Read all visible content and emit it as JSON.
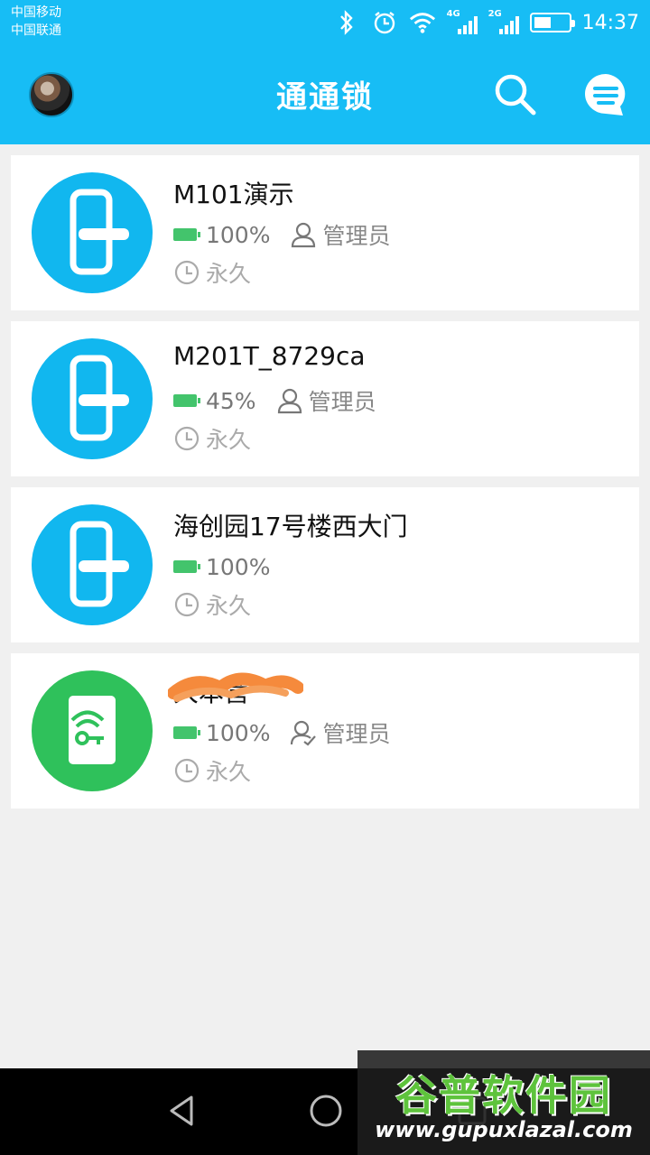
{
  "status_bar": {
    "carrier_1": "中国移动",
    "carrier_2": "中国联通",
    "signal_1_label": "4G",
    "signal_2_label": "2G",
    "time": "14:37"
  },
  "app_bar": {
    "title": "通通锁",
    "color": "#17bdf5"
  },
  "locks": [
    {
      "name": "M101演示",
      "battery": "100%",
      "role": "管理员",
      "validity": "永久",
      "icon": "door-lock-icon",
      "icon_color": "#11b7ef"
    },
    {
      "name": "M201T_8729ca",
      "battery": "45%",
      "role": "管理员",
      "validity": "永久",
      "icon": "door-lock-icon",
      "icon_color": "#11b7ef"
    },
    {
      "name": "海创园17号楼西大门",
      "battery": "100%",
      "role": "",
      "validity": "永久",
      "icon": "door-lock-icon",
      "icon_color": "#11b7ef"
    },
    {
      "name": "大本营",
      "battery": "100%",
      "role": "管理员",
      "validity": "永久",
      "icon": "key-card-icon",
      "icon_color": "#2fc15b"
    }
  ],
  "watermark": {
    "title": "谷普软件园",
    "url": "www.gupuxlazal.com"
  }
}
